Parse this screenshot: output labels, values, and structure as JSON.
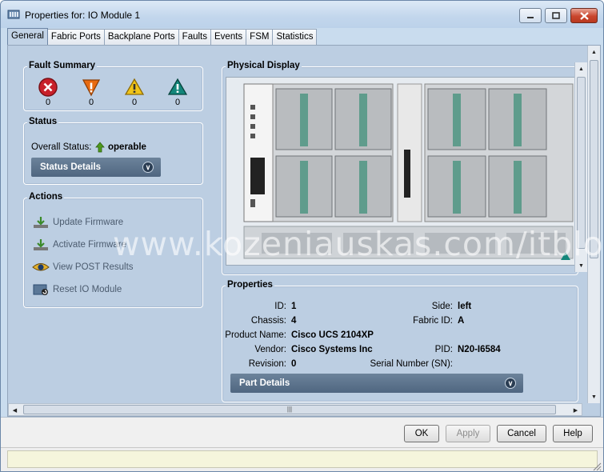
{
  "window": {
    "title": "Properties for: IO Module 1"
  },
  "tabs": [
    {
      "label": "General"
    },
    {
      "label": "Fabric Ports"
    },
    {
      "label": "Backplane Ports"
    },
    {
      "label": "Faults"
    },
    {
      "label": "Events"
    },
    {
      "label": "FSM"
    },
    {
      "label": "Statistics"
    }
  ],
  "fault_summary": {
    "title": "Fault Summary",
    "critical": "0",
    "major": "0",
    "minor": "0",
    "warning": "0"
  },
  "status": {
    "title": "Status",
    "overall_label": "Overall Status:",
    "overall_value": "operable",
    "details_label": "Status Details"
  },
  "actions": {
    "title": "Actions",
    "items": [
      {
        "label": "Update Firmware",
        "icon": "download-icon"
      },
      {
        "label": "Activate Firmware",
        "icon": "download-icon"
      },
      {
        "label": "View POST Results",
        "icon": "eye-icon"
      },
      {
        "label": "Reset IO Module",
        "icon": "reset-icon"
      }
    ]
  },
  "physical_display": {
    "title": "Physical Display"
  },
  "properties": {
    "title": "Properties",
    "id_label": "ID:",
    "id_value": "1",
    "side_label": "Side:",
    "side_value": "left",
    "chassis_label": "Chassis:",
    "chassis_value": "4",
    "fabric_label": "Fabric ID:",
    "fabric_value": "A",
    "product_label": "Product Name:",
    "product_value": "Cisco UCS 2104XP",
    "vendor_label": "Vendor:",
    "vendor_value": "Cisco Systems Inc",
    "pid_label": "PID:",
    "pid_value": "N20-I6584",
    "revision_label": "Revision:",
    "revision_value": "0",
    "serial_label": "Serial Number (SN):",
    "serial_value": "",
    "part_details_label": "Part Details"
  },
  "buttons": {
    "ok": "OK",
    "apply": "Apply",
    "cancel": "Cancel",
    "help": "Help"
  },
  "watermark": "www.kozeniauskas.com/itblog",
  "colors": {
    "critical": "#c8202a",
    "major": "#e86a10",
    "minor": "#f0c419",
    "warning": "#13867a",
    "operable": "#4f9a1c"
  }
}
